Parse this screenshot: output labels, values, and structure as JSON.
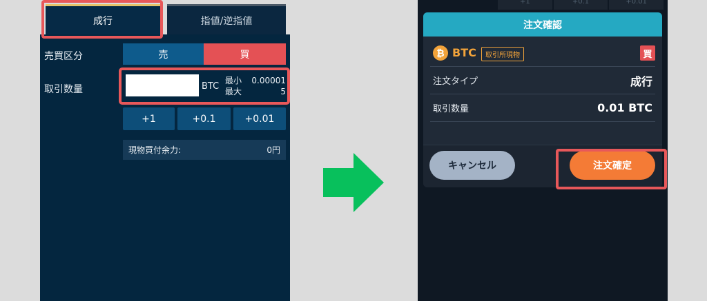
{
  "left": {
    "tabs": {
      "market": "成行",
      "limit": "指値/逆指値"
    },
    "side_label": "売買区分",
    "sell": "売",
    "buy": "買",
    "qty_label": "取引数量",
    "qty_value": "",
    "qty_unit": "BTC",
    "min_label": "最小",
    "min_value": "0.00001",
    "max_label": "最大",
    "max_value": "5",
    "increments": [
      "+1",
      "+0.1",
      "+0.01"
    ],
    "balance_label": "現物買付余力:",
    "balance_value": "0円"
  },
  "right": {
    "bg_tabs": [
      "+1",
      "+0.1",
      "+0.01"
    ],
    "modal_title": "注文確認",
    "asset_code": "BTC",
    "asset_type": "取引所現物",
    "side_badge": "買",
    "rows": [
      {
        "label": "注文タイプ",
        "value": "成行"
      },
      {
        "label": "取引数量",
        "value": "0.01 BTC"
      }
    ],
    "cancel": "キャンセル",
    "confirm": "注文確定"
  },
  "colors": {
    "highlight": "#e8585a",
    "arrow": "#08c05c",
    "buy": "#e45155",
    "confirm": "#f47b36",
    "modal_header": "#25a9c2"
  }
}
